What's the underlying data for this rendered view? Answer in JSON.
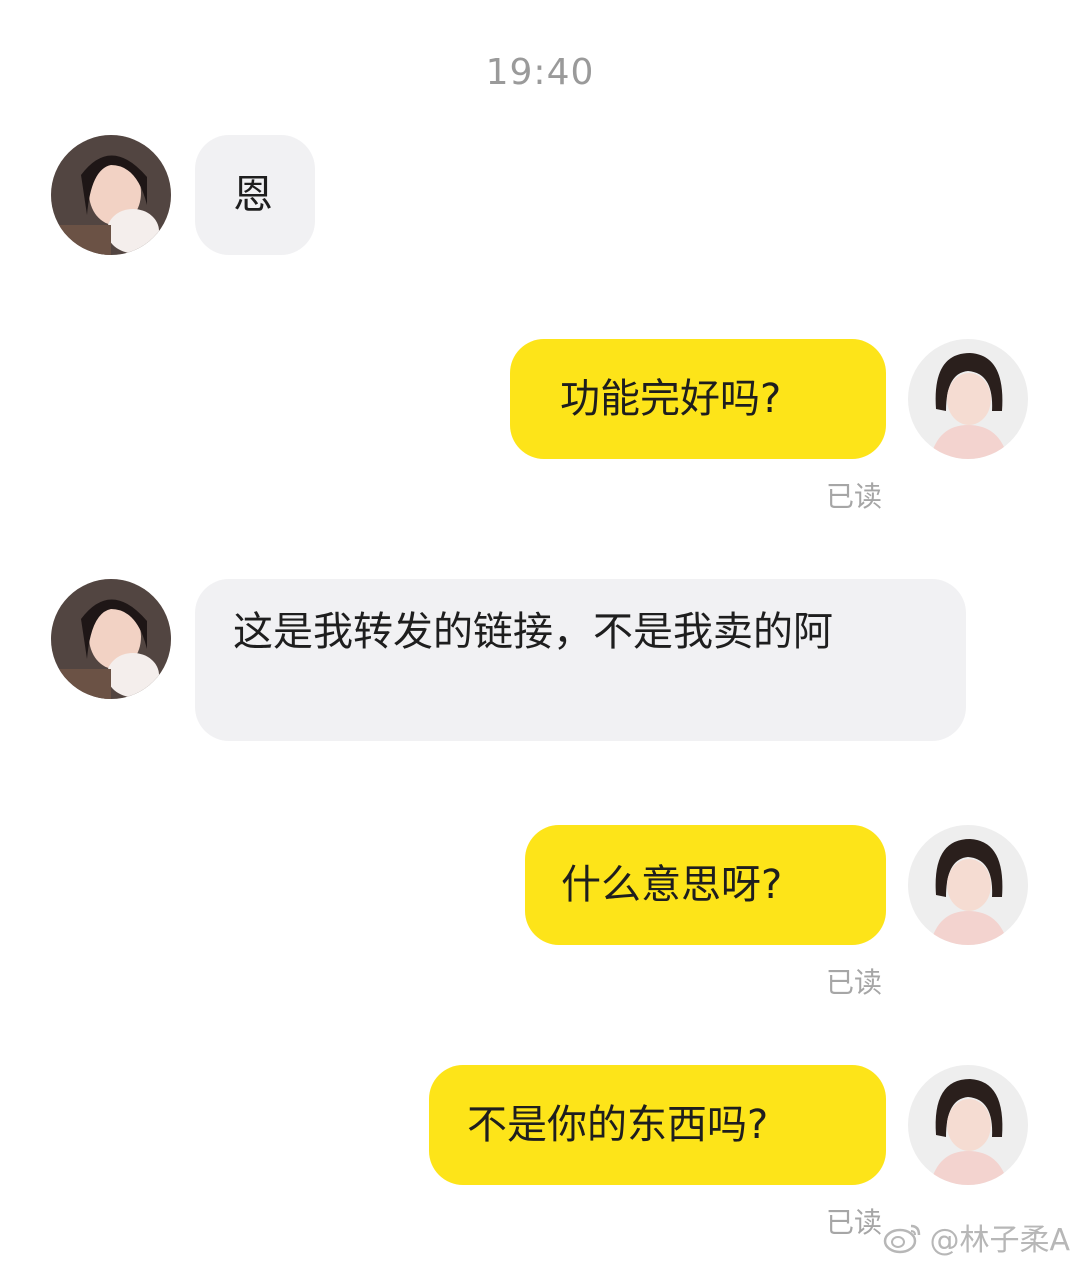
{
  "chat": {
    "timestamp": "19:40",
    "messages": [
      {
        "side": "left",
        "text": "恩"
      },
      {
        "side": "right",
        "text": "功能完好吗?",
        "status": "已读"
      },
      {
        "side": "left",
        "text": "这是我转发的链接，不是我卖的阿"
      },
      {
        "side": "right",
        "text": "什么意思呀?",
        "status": "已读"
      },
      {
        "side": "right",
        "text": "不是你的东西吗?",
        "status": "已读"
      }
    ]
  },
  "watermark": {
    "icon": "weibo-icon",
    "text": "@林子柔A"
  },
  "colors": {
    "self_bubble": "#fde419",
    "other_bubble": "#f1f1f3",
    "read_status": "#a6a6a6",
    "timestamp": "#9a9a9a"
  }
}
